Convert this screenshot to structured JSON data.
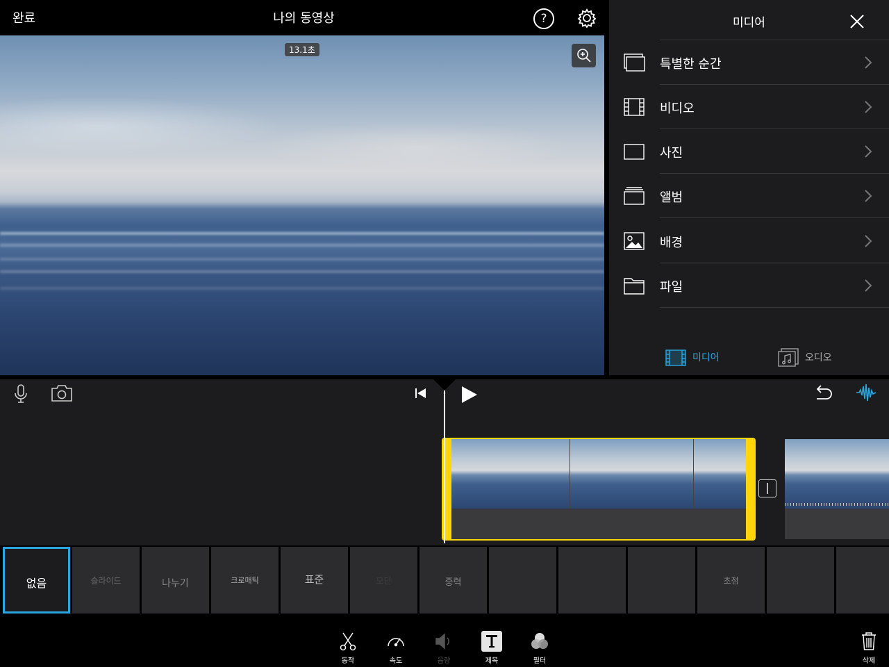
{
  "topbar": {
    "done_label": "완료",
    "title": "나의 동영상",
    "help_label": "?"
  },
  "viewer": {
    "duration": "13.1초"
  },
  "media_panel": {
    "title": "미디어",
    "items": [
      {
        "label": "특별한 순간",
        "icon": "moments-icon"
      },
      {
        "label": "비디오",
        "icon": "film-icon"
      },
      {
        "label": "사진",
        "icon": "photo-icon"
      },
      {
        "label": "앨범",
        "icon": "album-icon"
      },
      {
        "label": "배경",
        "icon": "background-icon"
      },
      {
        "label": "파일",
        "icon": "folder-icon"
      }
    ],
    "tabs": {
      "media": "미디어",
      "audio": "오디오"
    },
    "accent": "#2aa7e0"
  },
  "timeline": {
    "transition_label": "|"
  },
  "transitions": [
    "없음",
    "슬라이드",
    "나누기",
    "크로매틱",
    "표준",
    "모던",
    "중력",
    "",
    "",
    "",
    "초점",
    "",
    ""
  ],
  "toolbar": {
    "tools": [
      {
        "label": "동작",
        "icon": "scissors-icon"
      },
      {
        "label": "속도",
        "icon": "speedometer-icon"
      },
      {
        "label": "음량",
        "icon": "volume-icon"
      },
      {
        "label": "제목",
        "icon": "title-icon"
      },
      {
        "label": "필터",
        "icon": "filter-icon"
      }
    ],
    "delete_label": "삭제"
  },
  "colors": {
    "clip_border": "#ffd60a",
    "panel_bg": "#1c1c1e"
  }
}
